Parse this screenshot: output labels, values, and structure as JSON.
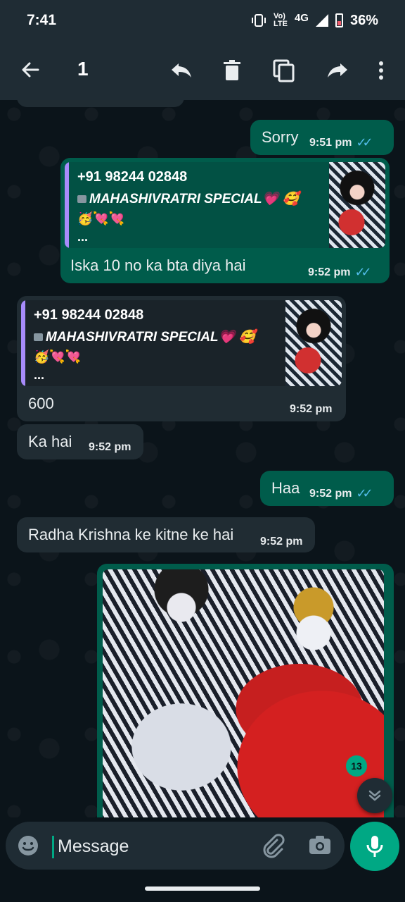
{
  "status_bar": {
    "time": "7:41",
    "network_top": "Vo)",
    "network_bottom": "LTE",
    "network_type": "4G",
    "battery": "36%"
  },
  "action_bar": {
    "selected_count": "1",
    "icons": [
      "back-arrow-icon",
      "reply-icon",
      "delete-icon",
      "copy-icon",
      "forward-icon",
      "more-vert-icon"
    ]
  },
  "messages": [
    {
      "direction": "out",
      "text": "Sorry",
      "time": "9:51 pm",
      "ticks": "✓✓"
    },
    {
      "direction": "out",
      "quote": {
        "sender": "+91 98244 02848",
        "text": "MAHASHIVRATRI SPECIAL💗 🥰",
        "emoji_line": "🥳💘💘",
        "dots": "..."
      },
      "text": "Iska 10 no ka bta diya hai",
      "time": "9:52 pm",
      "ticks": "✓✓"
    },
    {
      "direction": "in",
      "quote": {
        "sender": "+91 98244 02848",
        "text": "MAHASHIVRATRI SPECIAL💗 🥰",
        "emoji_line": "🥳💘💘",
        "dots": "..."
      },
      "text": "600",
      "time": "9:52 pm"
    },
    {
      "direction": "in",
      "text": "Ka hai",
      "time": "9:52 pm"
    },
    {
      "direction": "out",
      "text": "Haa",
      "time": "9:52 pm",
      "ticks": "✓✓"
    },
    {
      "direction": "in",
      "text": "Radha Krishna ke kitne ke hai",
      "time": "9:52 pm"
    }
  ],
  "photo_message": {
    "unread_badge": "13"
  },
  "composer": {
    "placeholder": "Message"
  },
  "colors": {
    "background": "#0b141a",
    "incoming": "#202c33",
    "outgoing": "#005c4b",
    "accent": "#00a884",
    "read_ticks": "#53bdeb"
  }
}
